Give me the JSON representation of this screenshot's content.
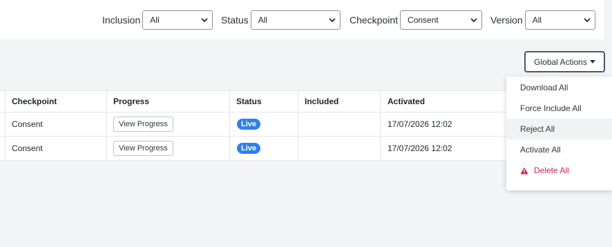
{
  "filters": {
    "inclusion": {
      "label": "Inclusion",
      "value": "All"
    },
    "status": {
      "label": "Status",
      "value": "All"
    },
    "checkpoint": {
      "label": "Checkpoint",
      "value": "Consent"
    },
    "version": {
      "label": "Version",
      "value": "All"
    }
  },
  "global_actions": {
    "label": "Global Actions",
    "menu": [
      {
        "label": "Download All"
      },
      {
        "label": "Force Include All"
      },
      {
        "label": "Reject All"
      },
      {
        "label": "Activate All"
      },
      {
        "label": "Delete All"
      }
    ]
  },
  "table": {
    "headers": [
      "Checkpoint",
      "Progress",
      "Status",
      "Included",
      "Activated"
    ],
    "rows": [
      {
        "checkpoint": "Consent",
        "progress_button": "View Progress",
        "status": "Live",
        "included": "",
        "activated": "17/07/2026 12:02"
      },
      {
        "checkpoint": "Consent",
        "progress_button": "View Progress",
        "status": "Live",
        "included": "",
        "activated": "17/07/2026 12:02"
      }
    ]
  },
  "colors": {
    "live_badge": "#2f80ed",
    "danger": "#d6204a",
    "background": "#f3f4f6"
  }
}
